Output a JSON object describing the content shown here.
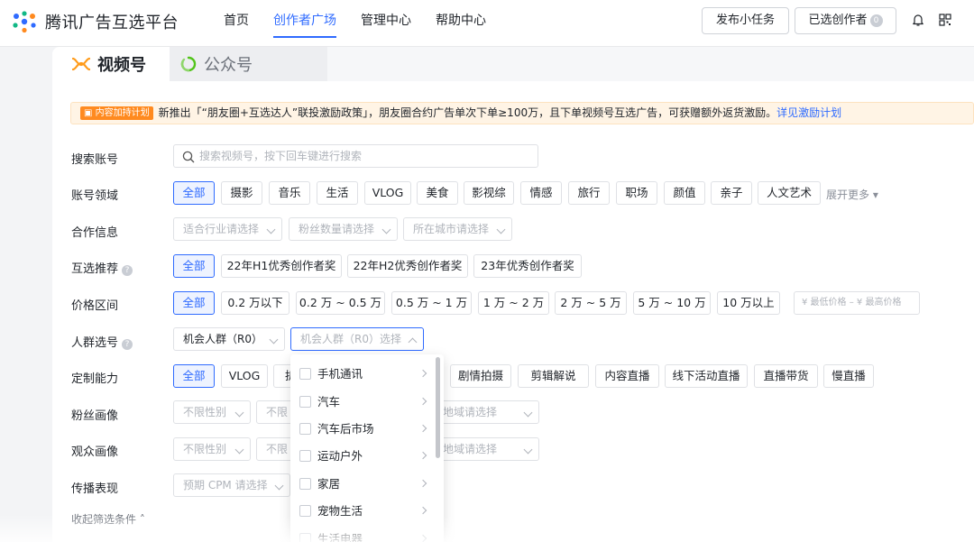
{
  "header": {
    "brand": "腾讯广告互选平台",
    "nav": [
      "首页",
      "创作者广场",
      "管理中心",
      "帮助中心"
    ],
    "active_nav": "创作者广场",
    "publish_task": "发布小任务",
    "selected_creators": "已选创作者",
    "selected_count": "0"
  },
  "tabs": {
    "active": "视频号",
    "inactive": "公众号"
  },
  "notice": {
    "tag": "内容加持计划",
    "text": "新推出「“朋友圈+互选达人”联投激励政策」，朋友圈合约广告单次下单≥100万，且下单视频号互选广告，可获赠额外返货激励。",
    "link": "详见激励计划"
  },
  "filters": {
    "search": {
      "label": "搜索账号",
      "placeholder": "搜索视频号，按下回车键进行搜索"
    },
    "domain": {
      "label": "账号领域",
      "options": [
        "全部",
        "摄影",
        "音乐",
        "生活",
        "VLOG",
        "美食",
        "影视综",
        "情感",
        "旅行",
        "职场",
        "颜值",
        "亲子",
        "人文艺术"
      ],
      "more": "展开更多"
    },
    "cooperation": {
      "label": "合作信息",
      "selects": [
        "适合行业请选择",
        "粉丝数量请选择",
        "所在城市请选择"
      ]
    },
    "recommend": {
      "label": "互选推荐",
      "options": [
        "全部",
        "22年H1优秀创作者奖",
        "22年H2优秀创作者奖",
        "23年优秀创作者奖"
      ]
    },
    "price": {
      "label": "价格区间",
      "options": [
        "全部",
        "0.2 万以下",
        "0.2 万 ~ 0.5 万",
        "0.5 万 ~ 1 万",
        "1 万 ~ 2 万",
        "2 万 ~ 5 万",
        "5 万 ~ 10 万",
        "10 万以上"
      ],
      "min_placeholder": "¥ 最低价格",
      "separator": "–",
      "max_placeholder": "¥ 最高价格"
    },
    "crowd": {
      "label": "人群选号",
      "value": "机会人群（R0）",
      "placeholder": "机会人群（R0）选择"
    },
    "custom": {
      "label": "定制能力",
      "options": [
        "全部",
        "VLOG",
        "拆",
        "剧情拍摄",
        "剪辑解说",
        "内容直播",
        "线下活动直播",
        "直播带货",
        "慢直播"
      ]
    },
    "fan_profile": {
      "label": "粉丝画像",
      "gender": "不限性别",
      "age": "不限",
      "region": "地域请选择"
    },
    "audience_profile": {
      "label": "观众画像",
      "gender": "不限性别",
      "age": "不限",
      "region": "地域请选择"
    },
    "spread": {
      "label": "传播表现",
      "cpm": "预期 CPM 请选择"
    },
    "collapse": "收起筛选条件"
  },
  "dropdown": {
    "items": [
      "手机通讯",
      "汽车",
      "汽车后市场",
      "运动户外",
      "家居",
      "宠物生活",
      "生活电器"
    ]
  },
  "colors": {
    "accent": "#2f6bff",
    "notice_tag": "#ff8a1f"
  }
}
